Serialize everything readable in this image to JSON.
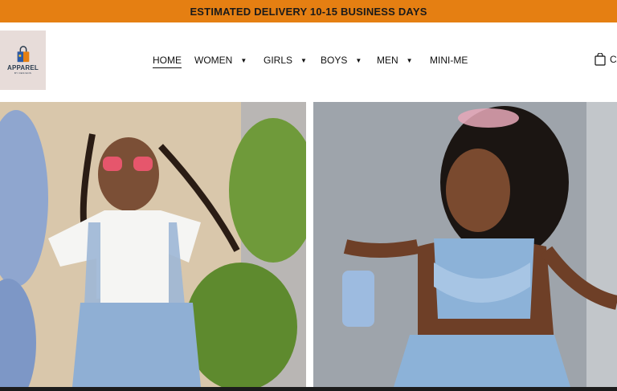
{
  "announcement": "ESTIMATED DELIVERY 10-15 BUSINESS DAYS",
  "logo": {
    "brand": "APPAREL",
    "sub": "BY DESIGNS",
    "icon": "shopping-bag-icon"
  },
  "nav": {
    "home": "HOME",
    "women": "WOMEN",
    "girls": "GIRLS",
    "boys": "BOYS",
    "men": "MEN",
    "mini_me": "MINI-ME",
    "caret": "▼"
  },
  "cart": {
    "label": "CART",
    "icon": "shopping-bag-icon"
  },
  "hero": {
    "left_image": "girl-white-blouse-denim-overall-dress",
    "right_image": "girl-denim-bow-top-ruffle-skirt"
  },
  "colors": {
    "announce_bg": "#e57f12",
    "logo_bg": "#e7dcd9"
  }
}
